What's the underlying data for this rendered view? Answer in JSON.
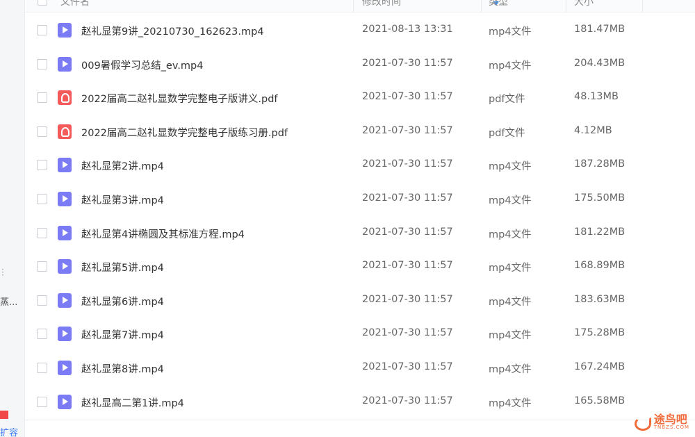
{
  "sidebar": {
    "partial_text": "蒸...",
    "bottom_text": "扩容"
  },
  "header": {
    "col_name": "文件名",
    "col_time": "修改时间",
    "col_type": "类型",
    "col_size": "大小"
  },
  "files": [
    {
      "name": "赵礼显第9讲_20210730_162623.mp4",
      "time": "2021-08-13 13:31",
      "type": "mp4文件",
      "size": "181.47MB",
      "icon": "video"
    },
    {
      "name": "009暑假学习总结_ev.mp4",
      "time": "2021-07-30 11:57",
      "type": "mp4文件",
      "size": "204.43MB",
      "icon": "video"
    },
    {
      "name": "2022届高二赵礼显数学完整电子版讲义.pdf",
      "time": "2021-07-30 11:57",
      "type": "pdf文件",
      "size": "48.13MB",
      "icon": "pdf"
    },
    {
      "name": "2022届高二赵礼显数学完整电子版练习册.pdf",
      "time": "2021-07-30 11:57",
      "type": "pdf文件",
      "size": "4.12MB",
      "icon": "pdf"
    },
    {
      "name": "赵礼显第2讲.mp4",
      "time": "2021-07-30 11:57",
      "type": "mp4文件",
      "size": "187.28MB",
      "icon": "video"
    },
    {
      "name": "赵礼显第3讲.mp4",
      "time": "2021-07-30 11:57",
      "type": "mp4文件",
      "size": "175.50MB",
      "icon": "video"
    },
    {
      "name": "赵礼显第4讲椭圆及其标准方程.mp4",
      "time": "2021-07-30 11:57",
      "type": "mp4文件",
      "size": "181.22MB",
      "icon": "video"
    },
    {
      "name": "赵礼显第5讲.mp4",
      "time": "2021-07-30 11:57",
      "type": "mp4文件",
      "size": "168.89MB",
      "icon": "video"
    },
    {
      "name": "赵礼显第6讲.mp4",
      "time": "2021-07-30 11:57",
      "type": "mp4文件",
      "size": "183.63MB",
      "icon": "video"
    },
    {
      "name": "赵礼显第7讲.mp4",
      "time": "2021-07-30 11:57",
      "type": "mp4文件",
      "size": "175.28MB",
      "icon": "video"
    },
    {
      "name": "赵礼显第8讲.mp4",
      "time": "2021-07-30 11:57",
      "type": "mp4文件",
      "size": "167.24MB",
      "icon": "video"
    },
    {
      "name": "赵礼显高二第1讲.mp4",
      "time": "2021-07-30 11:57",
      "type": "mp4文件",
      "size": "165.58MB",
      "icon": "video"
    }
  ],
  "watermark": {
    "main": "途鸟吧",
    "sub": "TNBZS.COM"
  },
  "colors": {
    "video_icon": "#7b7cf5",
    "pdf_icon": "#f55a5a",
    "accent": "#3a8df2"
  }
}
